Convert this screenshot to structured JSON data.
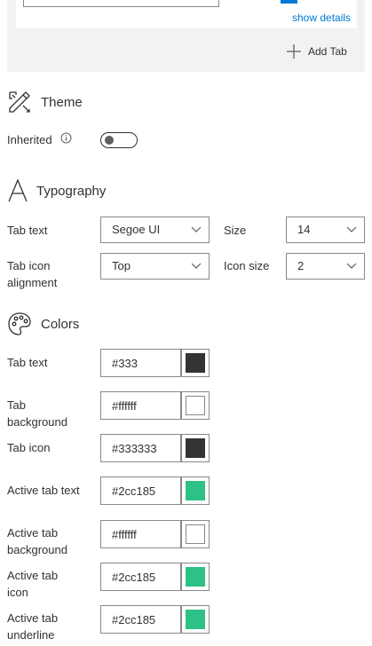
{
  "top_panel": {
    "show_details_link": "show details",
    "add_tab_label": "Add Tab"
  },
  "theme": {
    "title": "Theme",
    "inherited_label": "Inherited",
    "inherited_on": false
  },
  "typography": {
    "title": "Typography",
    "tab_text_label": "Tab text",
    "font_value": "Segoe UI",
    "size_label": "Size",
    "size_value": "14",
    "tab_icon_alignment_label_1": "Tab icon",
    "tab_icon_alignment_label_2": "alignment",
    "alignment_value": "Top",
    "icon_size_label": "Icon size",
    "icon_size_value": "2"
  },
  "colors": {
    "title": "Colors",
    "items": [
      {
        "label_1": "Tab text",
        "label_2": "",
        "value": "#333",
        "swatch": "#333333"
      },
      {
        "label_1": "Tab",
        "label_2": "background",
        "value": "#ffffff",
        "swatch": "#ffffff"
      },
      {
        "label_1": "Tab icon",
        "label_2": "",
        "value": "#333333",
        "swatch": "#333333"
      },
      {
        "label_1": "Active tab text",
        "label_2": "",
        "value": "#2cc185",
        "swatch": "#2cc185"
      },
      {
        "label_1": "Active tab",
        "label_2": "background",
        "value": "#ffffff",
        "swatch": "#ffffff"
      },
      {
        "label_1": "Active tab",
        "label_2": "icon",
        "value": "#2cc185",
        "swatch": "#2cc185"
      },
      {
        "label_1": "Active tab",
        "label_2": "underline",
        "value": "#2cc185",
        "swatch": "#2cc185"
      }
    ]
  }
}
